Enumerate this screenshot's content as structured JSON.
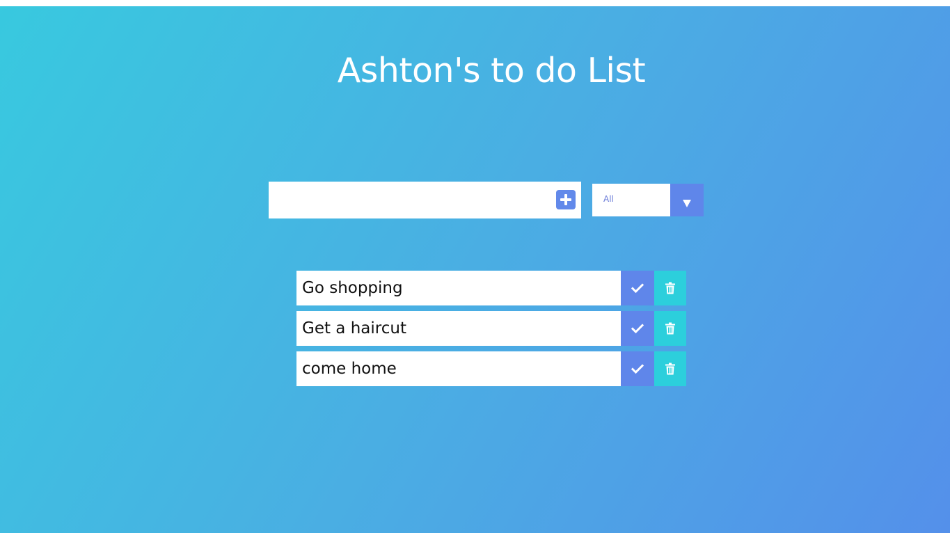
{
  "header": {
    "title": "Ashton's to do List"
  },
  "form": {
    "input_value": "",
    "add_icon": "plus-square-icon",
    "filter": {
      "selected": "All",
      "arrow_icon": "caret-down-icon"
    }
  },
  "todos": [
    {
      "text": "Go shopping",
      "complete_icon": "check-icon",
      "delete_icon": "trash-icon"
    },
    {
      "text": "Get a haircut",
      "complete_icon": "check-icon",
      "delete_icon": "trash-icon"
    },
    {
      "text": "come home",
      "complete_icon": "check-icon",
      "delete_icon": "trash-icon"
    }
  ],
  "colors": {
    "gradient_start": "#38c9df",
    "gradient_end": "#5490ea",
    "check_button": "#5f86ea",
    "trash_button": "#2ccfdc",
    "add_icon": "#6289ea"
  }
}
